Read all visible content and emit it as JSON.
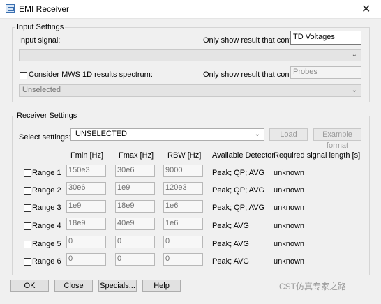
{
  "window": {
    "title": "EMI Receiver",
    "icon": "app-window-icon",
    "close_symbol": "✕"
  },
  "input_settings": {
    "legend": "Input Settings",
    "input_signal_label": "Input signal:",
    "filter_label": "Only show result that contain:",
    "filter_value": "TD Voltages",
    "input_signal_value": "",
    "consider_label": "Consider MWS 1D results spectrum:",
    "consider_checked": false,
    "filter2_label": "Only show result that contain:",
    "filter2_placeholder": "Probes",
    "spectrum_value": "Unselected"
  },
  "receiver_settings": {
    "legend": "Receiver Settings",
    "select_label": "Select settings:",
    "select_value": "UNSELECTED",
    "load_button": "Load",
    "example_button": "Example format",
    "headers": {
      "fmin": "Fmin [Hz]",
      "fmax": "Fmax [Hz]",
      "rbw": "RBW [Hz]",
      "detector": "Available Detector",
      "length": "Required signal length [s]"
    },
    "ranges": [
      {
        "label": "Range 1",
        "checked": false,
        "fmin": "150e3",
        "fmax": "30e6",
        "rbw": "9000",
        "detector": "Peak; QP; AVG",
        "length": "unknown"
      },
      {
        "label": "Range 2",
        "checked": false,
        "fmin": "30e6",
        "fmax": "1e9",
        "rbw": "120e3",
        "detector": "Peak; QP; AVG",
        "length": "unknown"
      },
      {
        "label": "Range 3",
        "checked": false,
        "fmin": "1e9",
        "fmax": "18e9",
        "rbw": "1e6",
        "detector": "Peak; QP; AVG",
        "length": "unknown"
      },
      {
        "label": "Range 4",
        "checked": false,
        "fmin": "18e9",
        "fmax": "40e9",
        "rbw": "1e6",
        "detector": "Peak; AVG",
        "length": "unknown"
      },
      {
        "label": "Range 5",
        "checked": false,
        "fmin": "0",
        "fmax": "0",
        "rbw": "0",
        "detector": "Peak; AVG",
        "length": "unknown"
      },
      {
        "label": "Range 6",
        "checked": false,
        "fmin": "0",
        "fmax": "0",
        "rbw": "0",
        "detector": "Peak; AVG",
        "length": "unknown"
      }
    ]
  },
  "buttons": {
    "ok": "OK",
    "close": "Close",
    "specials": "Specials...",
    "help": "Help"
  },
  "watermark": "CST仿真专家之路"
}
